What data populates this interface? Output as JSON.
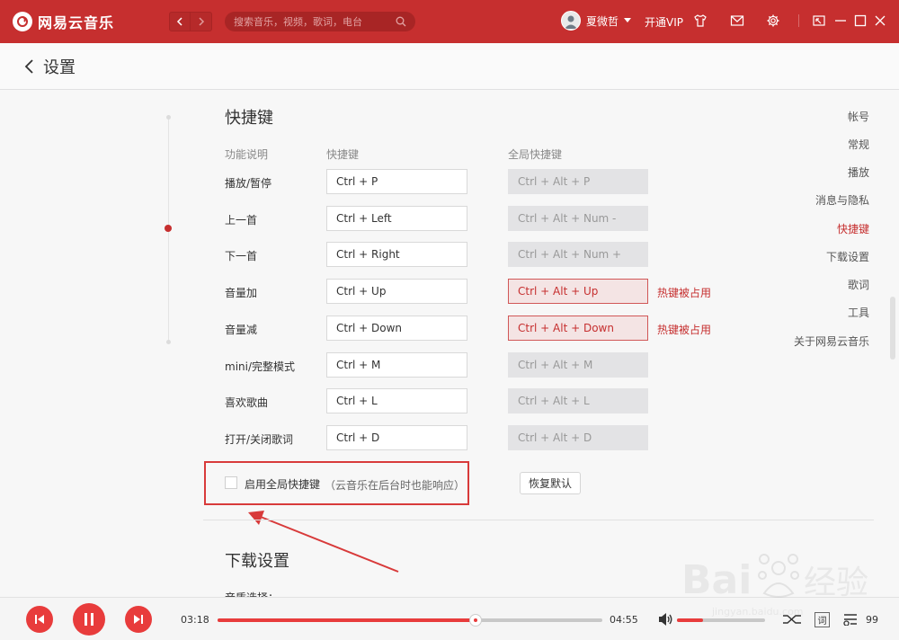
{
  "app": {
    "name": "网易云音乐"
  },
  "search": {
    "placeholder": "搜索音乐，视频，歌词，电台"
  },
  "user": {
    "name": "夏微哲",
    "vip_label": "开通VIP"
  },
  "header": {
    "title": "设置"
  },
  "nav": {
    "items": [
      "帐号",
      "常规",
      "播放",
      "消息与隐私",
      "快捷键",
      "下载设置",
      "歌词",
      "工具",
      "关于网易云音乐"
    ],
    "active": "快捷键"
  },
  "shortcuts": {
    "title": "快捷键",
    "headers": {
      "function": "功能说明",
      "shortcut": "快捷键",
      "global": "全局快捷键"
    },
    "conflict_text": "热键被占用",
    "rows": [
      {
        "label": "播放/暂停",
        "key": "Ctrl + P",
        "global": "Ctrl + Alt + P",
        "conflict": false
      },
      {
        "label": "上一首",
        "key": "Ctrl + Left",
        "global": "Ctrl + Alt + Num -",
        "conflict": false
      },
      {
        "label": "下一首",
        "key": "Ctrl + Right",
        "global": "Ctrl + Alt + Num +",
        "conflict": false
      },
      {
        "label": "音量加",
        "key": "Ctrl + Up",
        "global": "Ctrl + Alt + Up",
        "conflict": true
      },
      {
        "label": "音量减",
        "key": "Ctrl + Down",
        "global": "Ctrl + Alt + Down",
        "conflict": true
      },
      {
        "label": "mini/完整模式",
        "key": "Ctrl + M",
        "global": "Ctrl + Alt + M",
        "conflict": false
      },
      {
        "label": "喜欢歌曲",
        "key": "Ctrl + L",
        "global": "Ctrl + Alt + L",
        "conflict": false
      },
      {
        "label": "打开/关闭歌词",
        "key": "Ctrl + D",
        "global": "Ctrl + Alt + D",
        "conflict": false
      }
    ],
    "enable_global_label": "启用全局快捷键",
    "enable_global_checked": false,
    "enable_global_hint": "（云音乐在后台时也能响应）",
    "restore_label": "恢复默认"
  },
  "download": {
    "title": "下载设置",
    "first_label": "音质选择："
  },
  "player": {
    "current_time": "03:18",
    "total_time": "04:55",
    "progress": 0.67,
    "volume": 0.3,
    "lyric_label": "词",
    "playlist_count": "99"
  },
  "watermark": {
    "text": "Bai 经验",
    "url": "jingyan.baidu.com"
  },
  "colors": {
    "brand": "#c62f2f",
    "player_red": "#e83c3c",
    "annotation": "#d83a3a"
  },
  "icons": {
    "logo": "netease-logo-icon",
    "back": "back-arrow-icon",
    "forward": "forward-arrow-icon",
    "search": "search-icon",
    "skin": "tshirt-icon",
    "mail": "mail-icon",
    "settings": "gear-icon",
    "mini": "mini-mode-icon",
    "minimize": "minimize-icon",
    "maximize": "maximize-icon",
    "close": "close-icon"
  }
}
